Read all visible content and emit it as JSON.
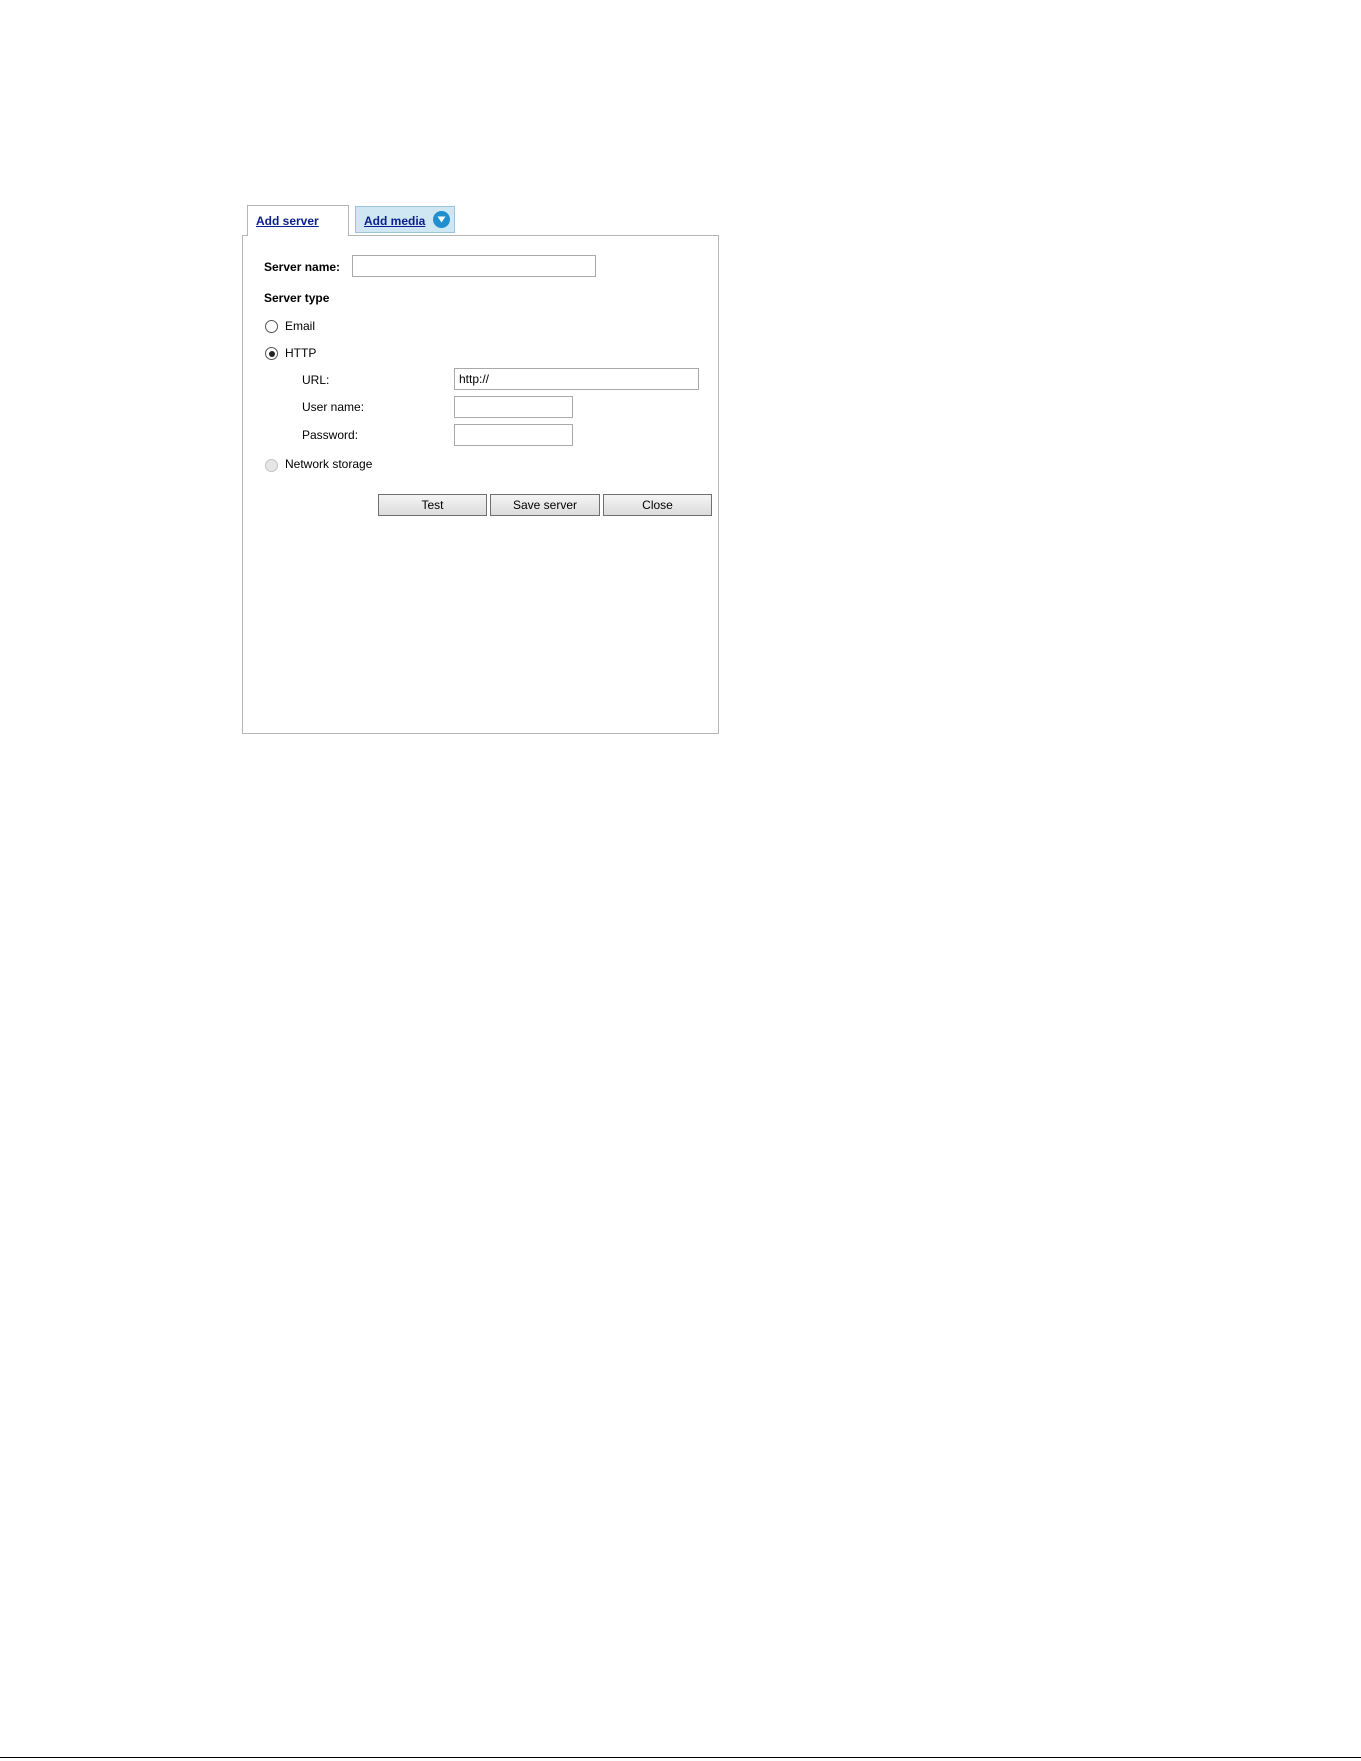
{
  "tabs": {
    "add_server": "Add server",
    "add_media": "Add media"
  },
  "form": {
    "server_name_label": "Server name:",
    "server_name_value": "",
    "server_type_label": "Server type",
    "options": {
      "email": "Email",
      "http": "HTTP",
      "network_storage": "Network storage"
    },
    "selected_option": "HTTP",
    "http": {
      "url_label": "URL:",
      "url_value": "http://",
      "username_label": "User name:",
      "username_value": "",
      "password_label": "Password:",
      "password_value": ""
    }
  },
  "buttons": {
    "test": "Test",
    "save_server": "Save server",
    "close": "Close"
  },
  "icons": {
    "dropdown": "chevron-down-circle-icon"
  },
  "colors": {
    "tab_link": "#0a1f8f",
    "media_tab_bg": "#cfe6f3",
    "dropdown_icon": "#1f8fd0"
  }
}
